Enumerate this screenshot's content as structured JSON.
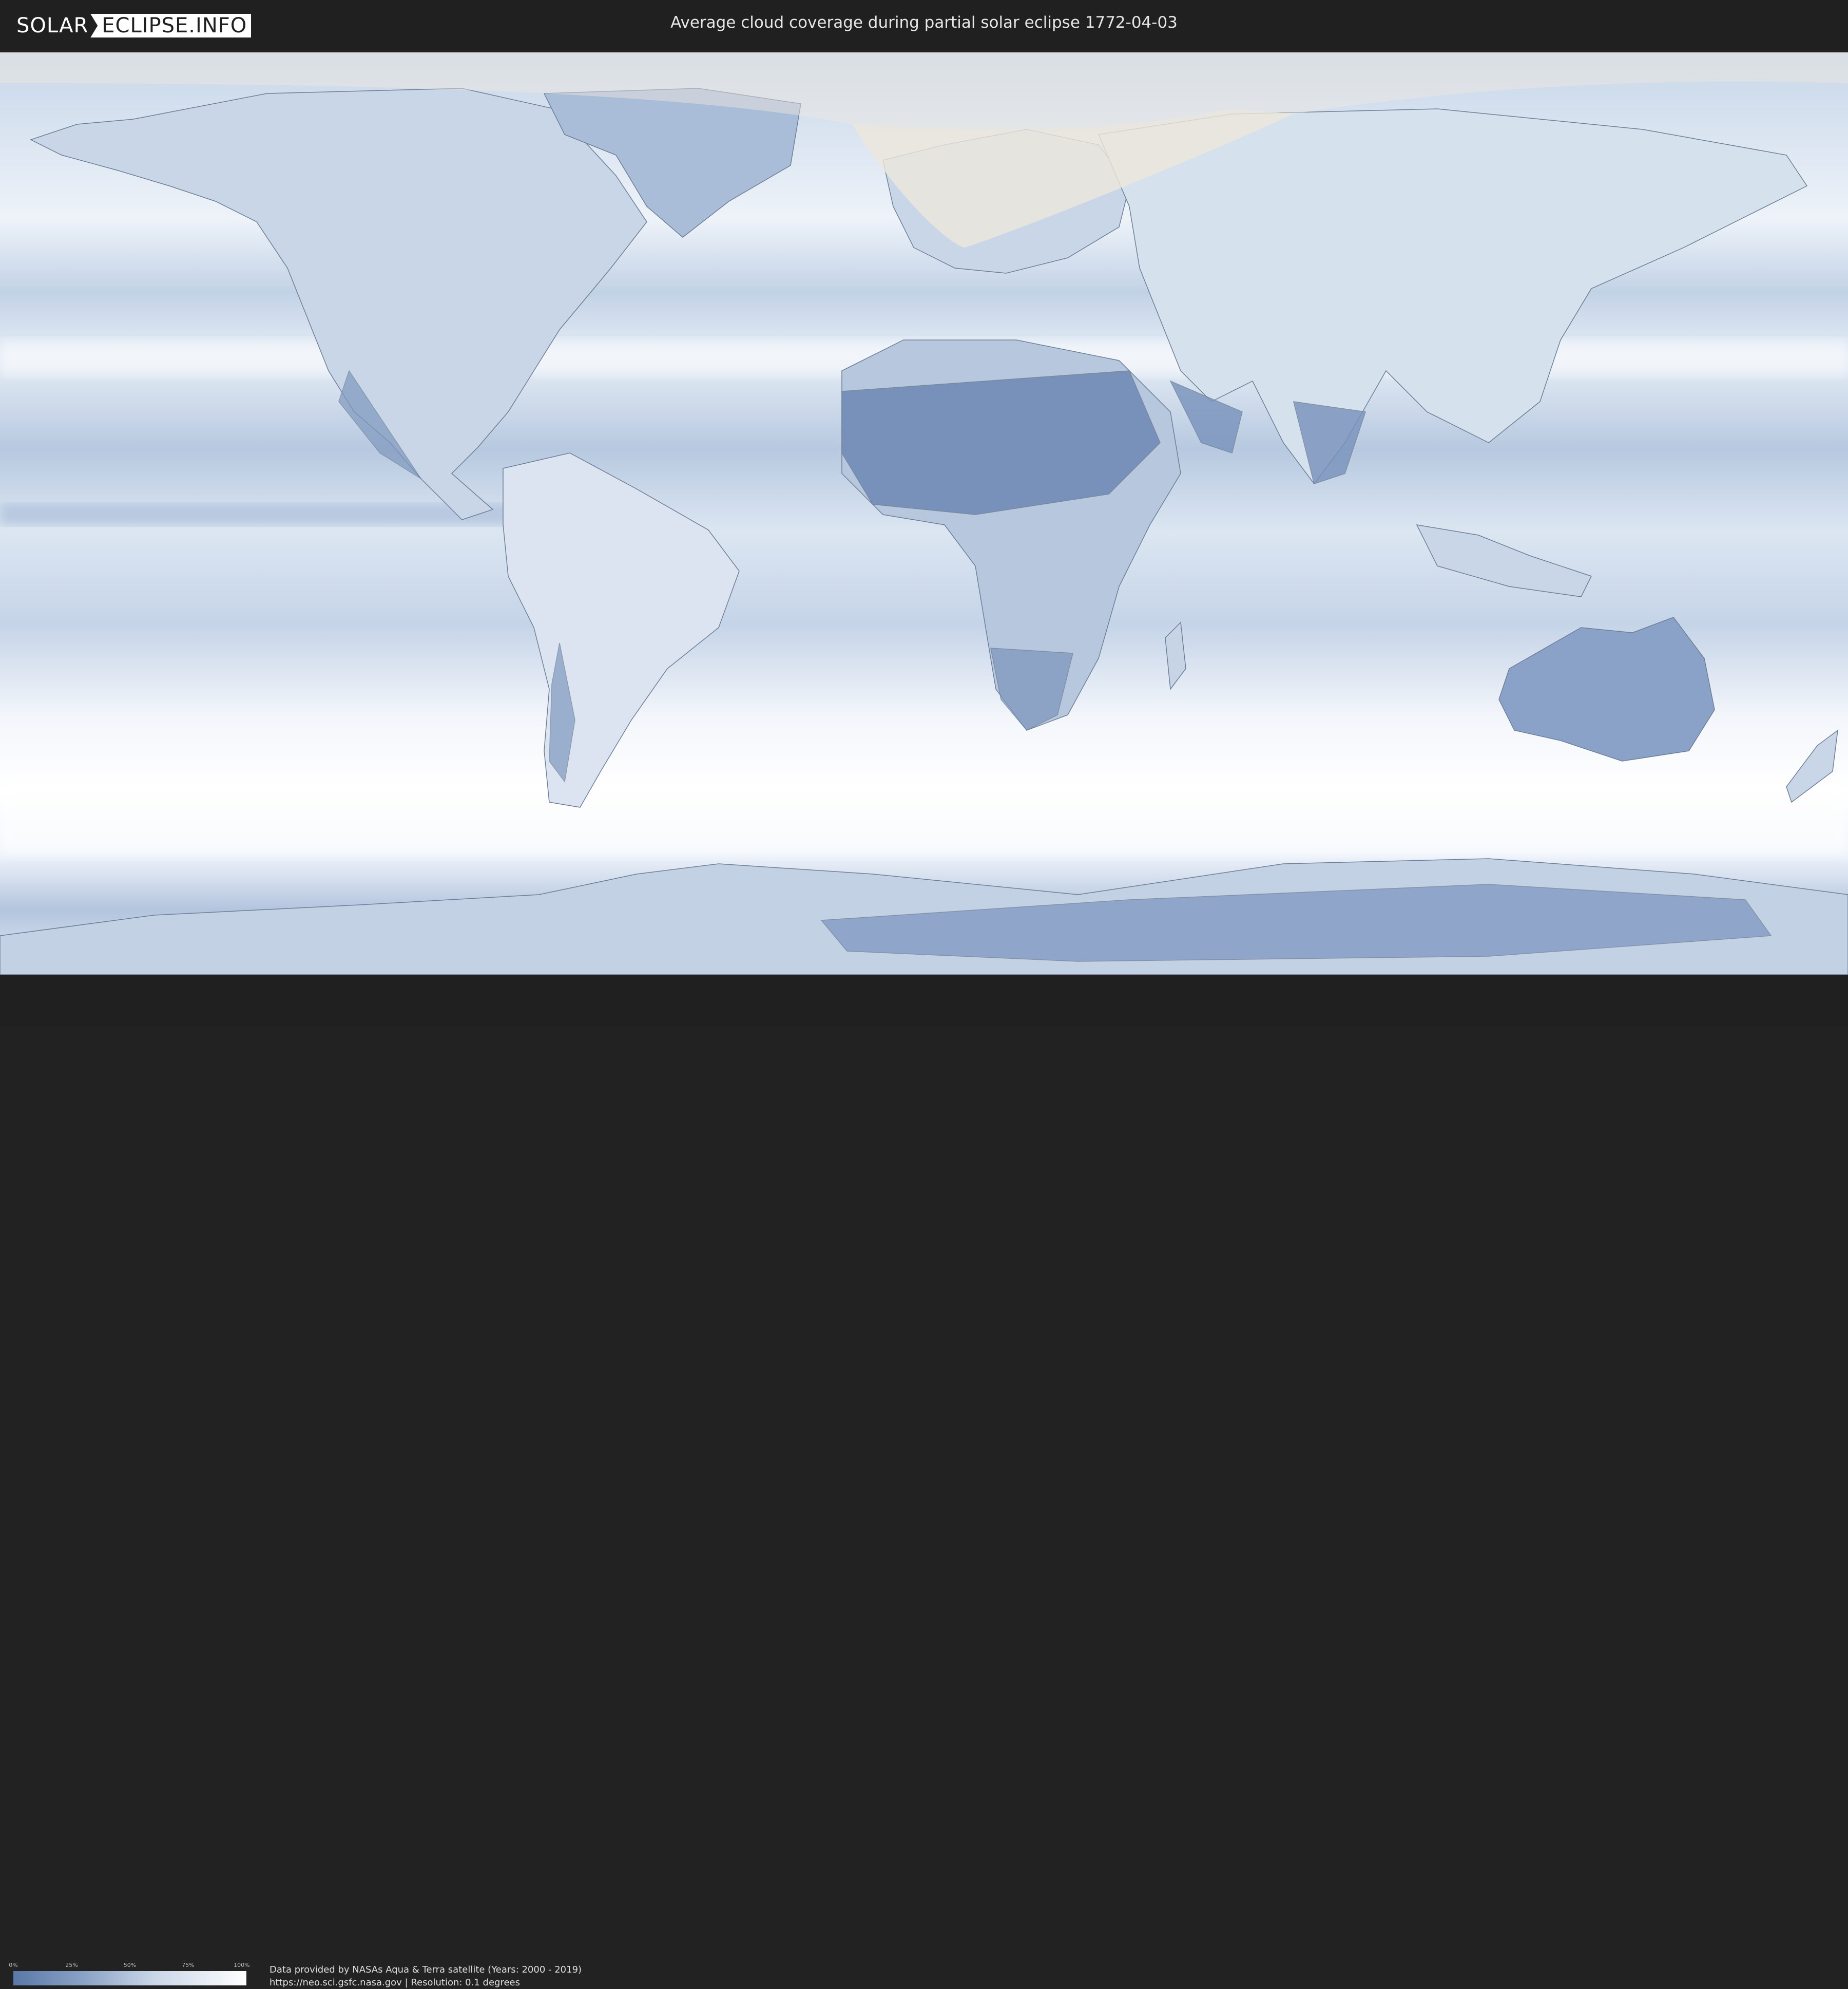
{
  "header": {
    "logo_part1": "SOLAR",
    "logo_part2": "ECLIPSE.INFO",
    "title": "Average cloud coverage during partial solar eclipse 1772-04-03"
  },
  "map": {
    "layer": "average cloud coverage",
    "colors": {
      "clear": "#5a78a8",
      "mid": "#a9bcd8",
      "cloudy": "#ffffff",
      "eclipse_overlay": "#e8e4dc",
      "coastline": "#6a7d95"
    }
  },
  "legend": {
    "ticks": [
      "0%",
      "25%",
      "50%",
      "75%",
      "100%"
    ]
  },
  "footer": {
    "credit_line1": "Data provided by NASAs Aqua & Terra satellite (Years: 2000 - 2019)",
    "credit_line2": "https://neo.sci.gsfc.nasa.gov | Resolution: 0.1 degrees"
  }
}
